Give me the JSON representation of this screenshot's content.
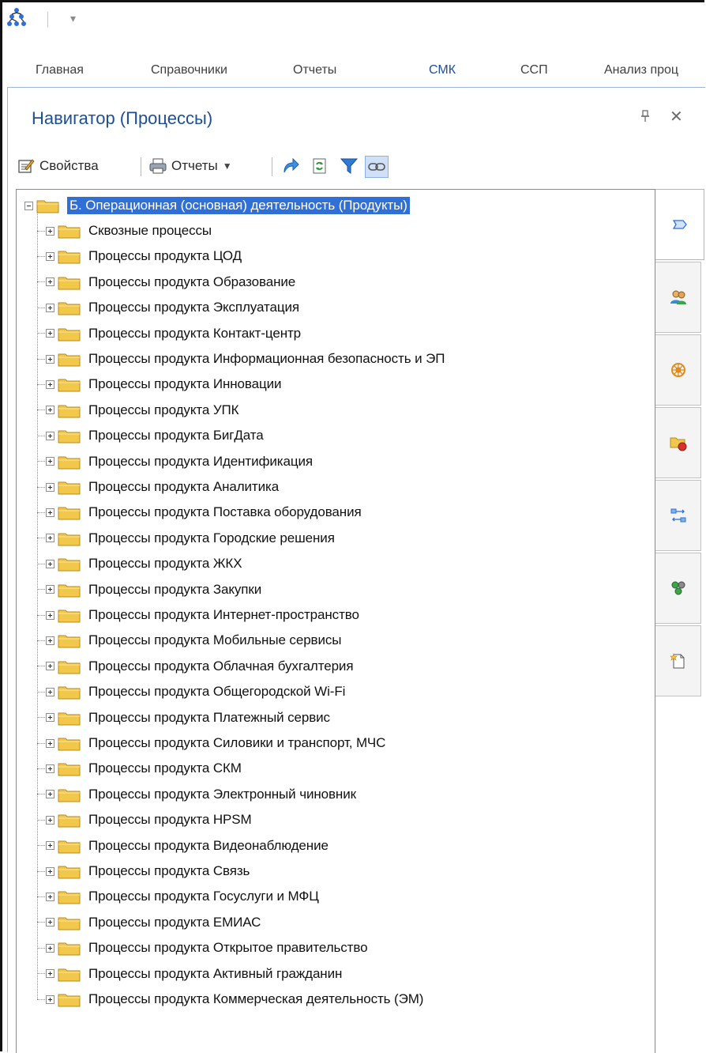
{
  "ribbon_tabs": [
    {
      "label": "Главная",
      "active": false
    },
    {
      "label": "Справочники",
      "active": false
    },
    {
      "label": "Отчеты",
      "active": false
    },
    {
      "label": "СМК",
      "active": true
    },
    {
      "label": "ССП",
      "active": false
    },
    {
      "label": "Анализ проц",
      "active": false
    }
  ],
  "panel": {
    "title": "Навигатор (Процессы)",
    "toolbar": {
      "properties_label": "Свойства",
      "reports_label": "Отчеты"
    }
  },
  "tree": {
    "root": {
      "label": "Б. Операционная (основная) деятельность (Продукты)",
      "expanded": true,
      "selected": true
    },
    "children": [
      "Сквозные процессы",
      "Процессы продукта ЦОД",
      "Процессы продукта Образование",
      "Процессы продукта Эксплуатация",
      "Процессы продукта Контакт-центр",
      "Процессы продукта Информационная безопасность и ЭП",
      "Процессы продукта Инновации",
      "Процессы продукта УПК",
      "Процессы продукта БигДата",
      "Процессы продукта Идентификация",
      "Процессы продукта Аналитика",
      "Процессы продукта Поставка оборудования",
      "Процессы продукта Городские решения",
      "Процессы продукта ЖКХ",
      "Процессы продукта Закупки",
      "Процессы продукта Интернет-пространство",
      "Процессы продукта Мобильные сервисы",
      "Процессы продукта Облачная бухгалтерия",
      "Процессы продукта Общегородской Wi-Fi",
      "Процессы продукта Платежный сервис",
      "Процессы продукта Силовики и транспорт, МЧС",
      "Процессы продукта СКМ",
      "Процессы продукта Электронный чиновник",
      "Процессы продукта HPSM",
      "Процессы продукта Видеонаблюдение",
      "Процессы продукта Связь",
      "Процессы продукта Госуслуги и МФЦ",
      "Процессы продукта ЕМИАС",
      "Процессы продукта Открытое правительство",
      "Процессы продукта Активный гражданин",
      "Процессы продукта Коммерческая деятельность (ЭМ)"
    ]
  },
  "side_tabs": [
    {
      "icon": "process-shape-icon",
      "active": true
    },
    {
      "icon": "users-icon",
      "active": false
    },
    {
      "icon": "wheel-icon",
      "active": false
    },
    {
      "icon": "folder-object-icon",
      "active": false
    },
    {
      "icon": "connections-icon",
      "active": false
    },
    {
      "icon": "group-icon",
      "active": false
    },
    {
      "icon": "new-document-icon",
      "active": false
    }
  ],
  "colors": {
    "accent": "#1d4f91",
    "selection": "#2f6fd6",
    "folder": "#f2c84b"
  }
}
